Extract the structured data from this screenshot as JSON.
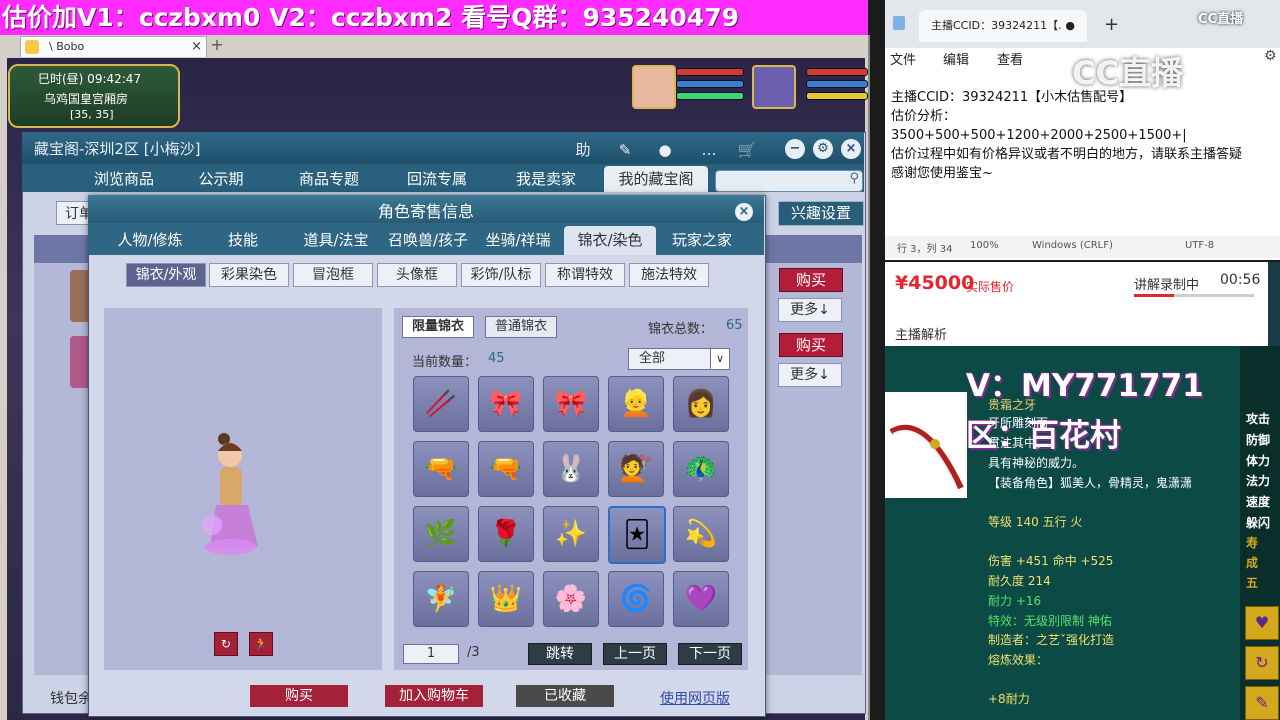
{
  "banner": {
    "text": "估价加V1：cczbxm0    V2：cczbxm2   看号Q群：935240479"
  },
  "browser": {
    "tab_title": "\\ Bobo",
    "tab_close": "×",
    "new_tab": "+"
  },
  "game": {
    "time": "巳时(昼) 09:42:47",
    "location": "乌鸡国皇宫厢房",
    "coords": "[35, 35]"
  },
  "treasure": {
    "title": "藏宝阁-深圳2区 [小梅沙]",
    "nav": [
      "浏览商品",
      "公示期",
      "商品专题",
      "回流专属",
      "我是卖家",
      "我的藏宝阁"
    ],
    "tools": [
      "助",
      "✎",
      "●",
      "…",
      "🛒"
    ],
    "win_buttons": [
      "−",
      "⚙",
      "×"
    ],
    "interest_label": "兴趣设置",
    "order_label": "订单",
    "buy_label": "购买",
    "more_label": "更多↓",
    "wallet_label": "钱包余"
  },
  "dialog": {
    "title": "角色寄售信息",
    "close": "×",
    "tabs": [
      "人物/修炼",
      "技能",
      "道具/法宝",
      "召唤兽/孩子",
      "坐骑/祥瑞",
      "锦衣/染色",
      "玩家之家"
    ],
    "subtabs": [
      "锦衣/外观",
      "彩果染色",
      "冒泡框",
      "头像框",
      "彩饰/队标",
      "称谓特效",
      "施法特效"
    ],
    "panel_tabs": [
      "限量锦衣",
      "普通锦衣"
    ],
    "total_label": "锦衣总数：",
    "total_value": "65",
    "current_label": "当前数量：",
    "current_value": "45",
    "filter_value": "全部",
    "filter_arrow": "∨",
    "slots": [
      "🥢",
      "🎀",
      "🎀",
      "👱",
      "👩",
      "🔫",
      "🔫",
      "🐰",
      "💇",
      "🦚",
      "🌿",
      "🌹",
      "✨",
      "🃏",
      "💫",
      "🧚",
      "👑",
      "🌸",
      "🌀",
      "💜"
    ],
    "page_input": "1",
    "page_total": "/3",
    "page_buttons": [
      "跳转",
      "上一页",
      "下一页"
    ],
    "bottom_buttons": [
      "购买",
      "加入购物车",
      "已收藏"
    ],
    "web_version": "使用网页版",
    "rotate_icon": "↻",
    "pose_icon": "🏃"
  },
  "notepad": {
    "tab_title": "主播CCID：39324211【.",
    "tab_close": "●",
    "new_tab": "+",
    "menu": [
      "文件",
      "编辑",
      "查看"
    ],
    "lines": [
      "主播CCID：39324211【小木估售配号】",
      "估价分析：",
      "3500+500+500+1200+2000+2500+1500+|",
      "估价过程中如有价格异议或者不明白的地方，请联系主播答疑",
      "感谢您使用鉴宝~"
    ],
    "status": [
      "行 3，列 34",
      "100%",
      "Windows (CRLF)",
      "UTF-8"
    ]
  },
  "cc": {
    "small_logo": "CC直播",
    "big_logo": "CC直播"
  },
  "price": {
    "value": "¥45000",
    "label": "实际售价",
    "recording": "讲解录制中",
    "time": "00:56",
    "analysis": "主播解析",
    "progress": 0.33
  },
  "item": {
    "vid": "V：MY771771",
    "area": "区：百花村",
    "lines": [
      {
        "text": "贵霜之牙",
        "color": "#f0d070"
      },
      {
        "text": "                         牙所雕刻而",
        "color": "#ffffff"
      },
      {
        "text": "                           贯注其中，",
        "color": "#ffffff"
      },
      {
        "text": "具有神秘的威力。",
        "color": "#ffffff"
      },
      {
        "text": "【装备角色】狐美人，骨精灵，鬼潇潇",
        "color": "#ffffff"
      },
      {
        "text": "等级 140 五行 火",
        "color": "#f0e070"
      },
      {
        "text": "伤害 +451 命中 +525",
        "color": "#f0e070"
      },
      {
        "text": "耐久度 214",
        "color": "#f0e070"
      },
      {
        "text": "耐力 +16",
        "color": "#59e06b"
      },
      {
        "text": "特效：无级别限制 神佑",
        "color": "#59e06b"
      },
      {
        "text": "制造者：之艺ˇ强化打造",
        "color": "#f0e070"
      },
      {
        "text": "熔炼效果：",
        "color": "#f0e070"
      },
      {
        "text": "+8耐力",
        "color": "#f0e070"
      }
    ],
    "side_stats": [
      "攻击",
      "防御",
      "体力",
      "法力",
      "速度",
      "躲闪",
      "寿",
      "成",
      "五"
    ]
  }
}
